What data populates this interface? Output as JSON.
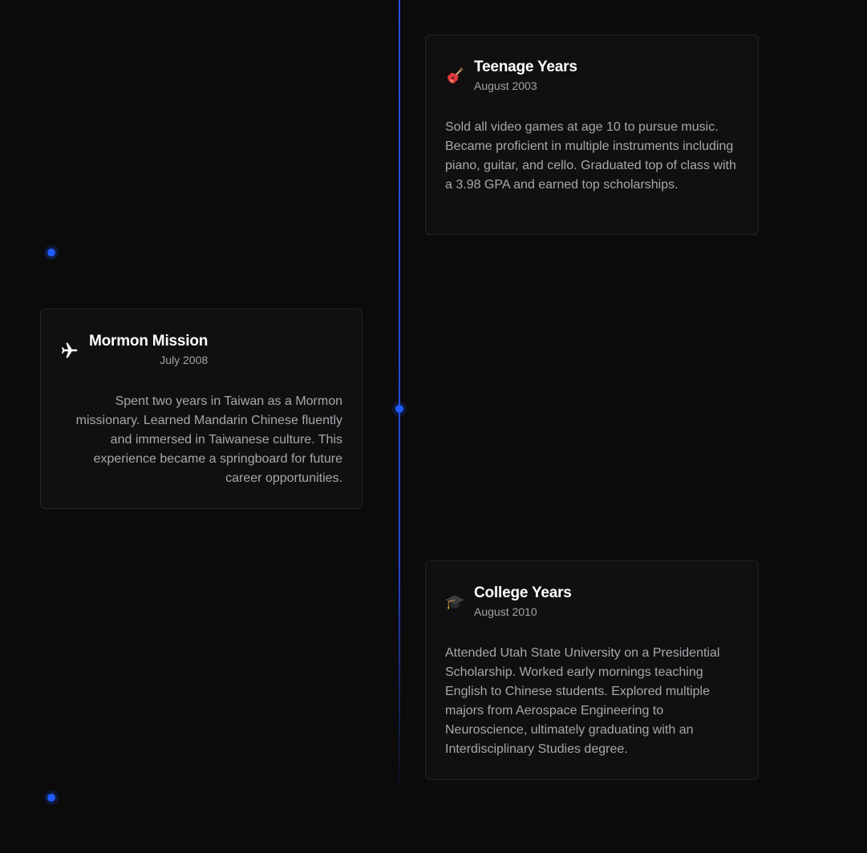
{
  "timeline": {
    "events": [
      {
        "title": "Teenage Years",
        "date": "August 2003",
        "icon": "guitar-icon",
        "description": "Sold all video games at age 10 to pursue music. Became proficient in multiple instruments including piano, guitar, and cello. Graduated top of class with a 3.98 GPA and earned top scholarships."
      },
      {
        "title": "Mormon Mission",
        "date": "July 2008",
        "icon": "airplane-icon",
        "description": "Spent two years in Taiwan as a Mormon missionary. Learned Mandarin Chinese fluently and immersed in Taiwanese culture. This experience became a springboard for future career opportunities."
      },
      {
        "title": "College Years",
        "date": "August 2010",
        "icon": "graduation-cap-icon",
        "description": "Attended Utah State University on a Presidential Scholarship. Worked early mornings teaching English to Chinese students. Explored multiple majors from Aerospace Engineering to Neuroscience, ultimately graduating with an Interdisciplinary Studies degree."
      }
    ]
  },
  "colors": {
    "background": "#0b0b0c",
    "card_background": "#101011",
    "card_border": "#232326",
    "accent": "#1f5bff",
    "title": "#ffffff",
    "text": "#a7a7ad"
  }
}
